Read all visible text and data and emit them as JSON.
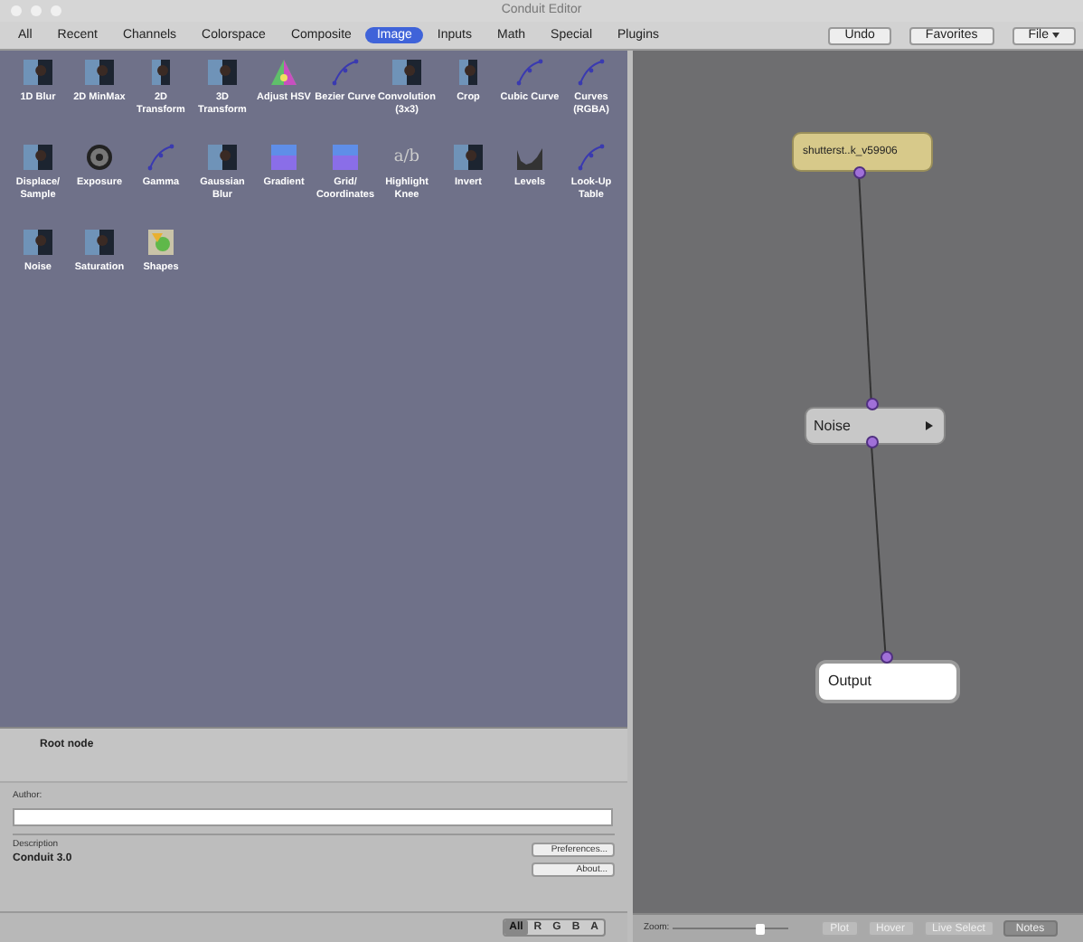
{
  "window": {
    "title": "Conduit Editor"
  },
  "tabs": [
    {
      "label": "All",
      "selected": false
    },
    {
      "label": "Recent",
      "selected": false
    },
    {
      "label": "Channels",
      "selected": false
    },
    {
      "label": "Colorspace",
      "selected": false
    },
    {
      "label": "Composite",
      "selected": false
    },
    {
      "label": "Image",
      "selected": true
    },
    {
      "label": "Inputs",
      "selected": false
    },
    {
      "label": "Math",
      "selected": false
    },
    {
      "label": "Special",
      "selected": false
    },
    {
      "label": "Plugins",
      "selected": false
    }
  ],
  "toolbar_buttons": [
    {
      "label": "Undo",
      "kind": "button"
    },
    {
      "label": "Favorites",
      "kind": "button"
    },
    {
      "label": "File",
      "kind": "menu"
    }
  ],
  "filters": [
    {
      "label": "1D Blur",
      "kind": "photo"
    },
    {
      "label": "2D MinMax",
      "kind": "photo"
    },
    {
      "label": "2D Transform",
      "kind": "small"
    },
    {
      "label": "3D Transform",
      "kind": "photo"
    },
    {
      "label": "Adjust HSV",
      "kind": "hsv"
    },
    {
      "label": "Bezier Curve",
      "kind": "curve"
    },
    {
      "label": "Convolution (3x3)",
      "kind": "photo"
    },
    {
      "label": "Crop",
      "kind": "small"
    },
    {
      "label": "Cubic Curve",
      "kind": "curve"
    },
    {
      "label": "Curves (RGBA)",
      "kind": "curve"
    },
    {
      "label": "Displace/ Sample",
      "kind": "photo"
    },
    {
      "label": "Exposure",
      "kind": "wheel"
    },
    {
      "label": "Gamma",
      "kind": "curve"
    },
    {
      "label": "Gaussian Blur",
      "kind": "photo"
    },
    {
      "label": "Gradient",
      "kind": "gradient"
    },
    {
      "label": "Grid/ Coordinates",
      "kind": "gradient"
    },
    {
      "label": "Highlight Knee",
      "kind": "glyph",
      "glyph": "a/b"
    },
    {
      "label": "Invert",
      "kind": "photo"
    },
    {
      "label": "Levels",
      "kind": "levels"
    },
    {
      "label": "Look-Up Table",
      "kind": "curve"
    },
    {
      "label": "Noise",
      "kind": "photo"
    },
    {
      "label": "Saturation",
      "kind": "photo"
    },
    {
      "label": "Shapes",
      "kind": "shapes"
    }
  ],
  "info": {
    "title": "Root node",
    "author_label": "Author:",
    "description_label": "Description",
    "description": "Conduit 3.0",
    "buttons": [
      "Preferences...",
      "About..."
    ]
  },
  "channels": [
    {
      "label": "All",
      "selected": true
    },
    {
      "label": "R",
      "selected": false
    },
    {
      "label": "G",
      "selected": false
    },
    {
      "label": "B",
      "selected": false
    },
    {
      "label": "A",
      "selected": false
    }
  ],
  "zoom": {
    "label": "Zoom:",
    "level": 0.78
  },
  "view_buttons": [
    {
      "label": "Plot",
      "selected": false
    },
    {
      "label": "Hover",
      "selected": false
    },
    {
      "label": "Live Select",
      "selected": false
    },
    {
      "label": "Notes",
      "selected": true
    }
  ],
  "graph": {
    "nodes": [
      {
        "label": "shutterst..k_v59906",
        "kind": "source"
      },
      {
        "label": "Noise",
        "kind": "filter"
      },
      {
        "label": "Output",
        "kind": "output"
      }
    ]
  }
}
